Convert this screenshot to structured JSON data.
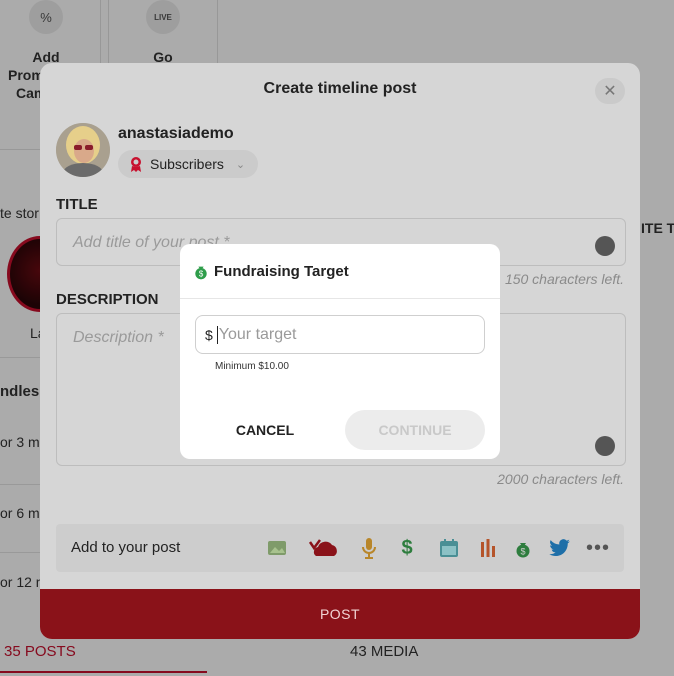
{
  "background": {
    "tiles": [
      {
        "label": "Add",
        "label2": "Promo",
        "label3": "Cam"
      },
      {
        "label": "Go",
        "live_badge": "LIVE"
      }
    ],
    "story_label": "te stor",
    "story_caption": "La",
    "side_te": "ITE TV",
    "bundles_label": "ndles",
    "bundle_items": [
      "or 3 m",
      "or 6 m",
      "or 12 m"
    ],
    "tabs": {
      "posts": "35 POSTS",
      "media": "43 MEDIA"
    }
  },
  "modal": {
    "title": "Create timeline post",
    "close_icon": "close-icon",
    "username": "anastasiademo",
    "audience": "Subscribers",
    "title_label": "TITLE",
    "title_placeholder": "Add title of your post *",
    "title_chars_left": "150 characters left.",
    "description_label": "DESCRIPTION",
    "description_placeholder": "Description *",
    "description_chars_left": "2000 characters left.",
    "add_to_post": "Add to your post",
    "post_button": "POST",
    "addbar_icons": [
      "image-icon",
      "cloud-vote-icon",
      "microphone-icon",
      "dollar-icon",
      "calendar-icon",
      "poll-icon",
      "money-bag-icon",
      "twitter-icon",
      "more-icon"
    ]
  },
  "dialog": {
    "title": "Fundraising Target",
    "currency": "$",
    "input_placeholder": "Your target",
    "minimum": "Minimum $10.00",
    "cancel": "CANCEL",
    "continue": "CONTINUE"
  },
  "colors": {
    "accent": "#c8102e",
    "post_button_dimmed": "#8a1219",
    "money_green": "#2e9d4a",
    "twitter_blue": "#1d9bf0"
  }
}
